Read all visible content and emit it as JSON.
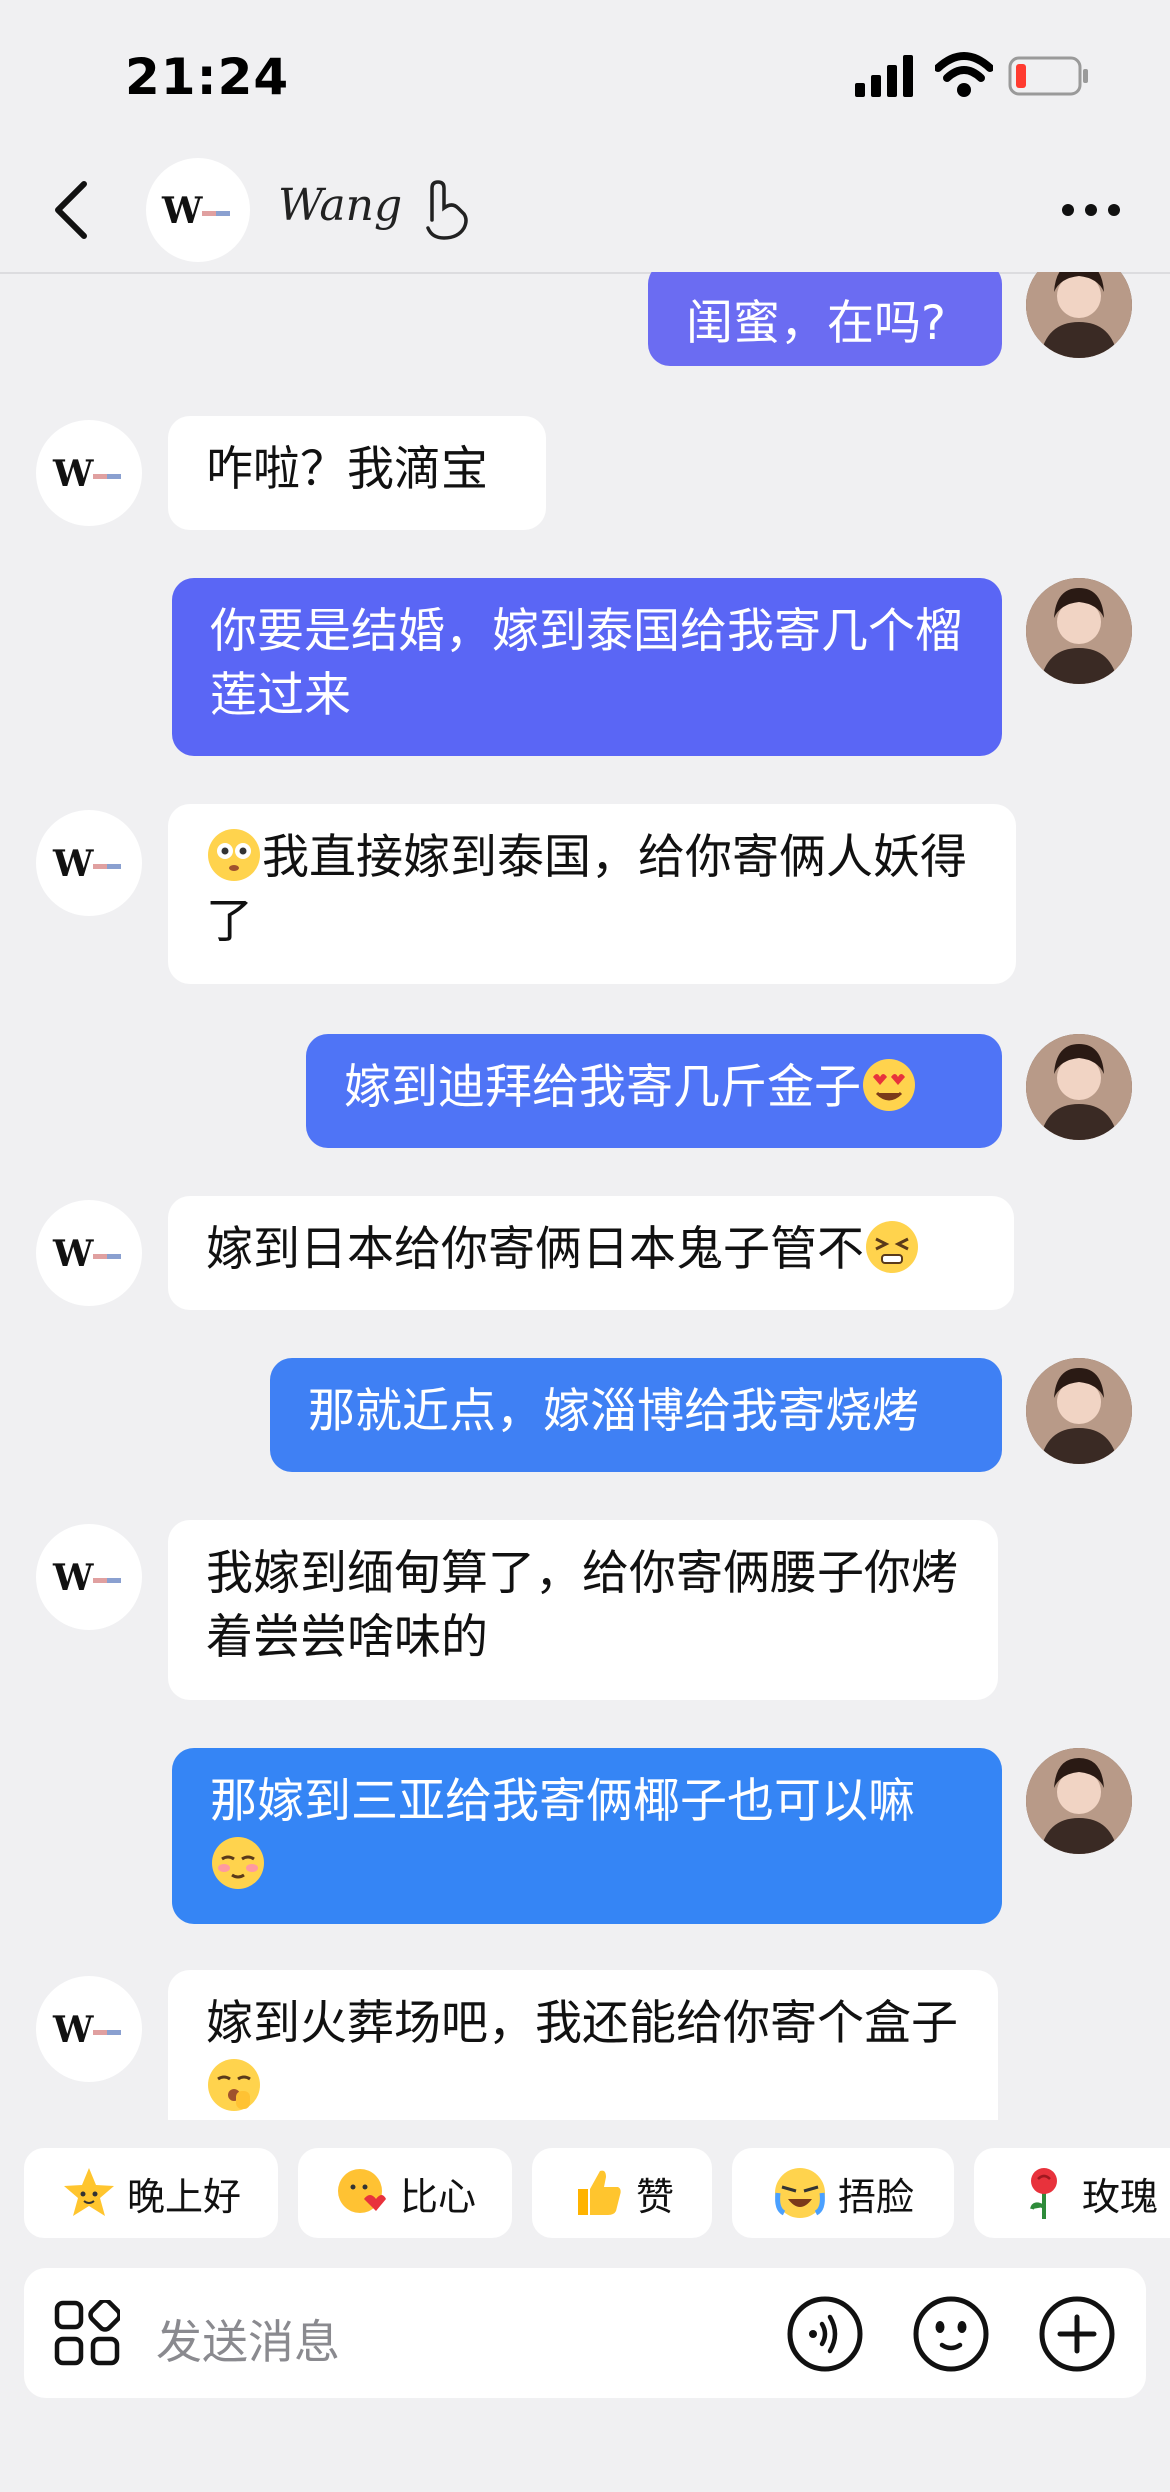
{
  "status_bar": {
    "time": "21:24"
  },
  "header": {
    "contact_name": "Wang",
    "avatar_text": "W"
  },
  "messages": [
    {
      "side": "out",
      "text": "闺蜜，在吗?"
    },
    {
      "side": "in",
      "text": "咋啦？我滴宝"
    },
    {
      "side": "out",
      "text": "你要是结婚，嫁到泰国给我寄几个榴莲过来"
    },
    {
      "side": "in",
      "text": "我直接嫁到泰国，给你寄俩人妖得了",
      "emoji_lead": "flushed-face"
    },
    {
      "side": "out",
      "text": "嫁到迪拜给我寄几斤金子",
      "emoji_tail": "heart-eyes-face"
    },
    {
      "side": "in",
      "text": "嫁到日本给你寄俩日本鬼子管不",
      "emoji_tail": "squinting-face"
    },
    {
      "side": "out",
      "text": "那就近点，嫁淄博给我寄烧烤"
    },
    {
      "side": "in",
      "text": "我嫁到缅甸算了，给你寄俩腰子你烤着尝尝啥味的"
    },
    {
      "side": "out",
      "text": "那嫁到三亚给我寄俩椰子也可以嘛",
      "emoji_tail": "shy-face"
    },
    {
      "side": "in",
      "text": "嫁到火葬场吧，我还能给你寄个盒子",
      "emoji_tail": "shushing-face"
    }
  ],
  "quick_replies": [
    {
      "label": "晚上好",
      "icon": "star-emoji"
    },
    {
      "label": "比心",
      "icon": "heart-hands-emoji"
    },
    {
      "label": "赞",
      "icon": "thumbs-up-emoji"
    },
    {
      "label": "捂脸",
      "icon": "facepalm-emoji"
    },
    {
      "label": "玫瑰",
      "icon": "rose-emoji"
    }
  ],
  "input": {
    "placeholder": "发送消息"
  },
  "colors": {
    "background": "#f0f0f2",
    "incoming_bubble": "#ffffff",
    "outgoing_gradient": [
      "#6b6cf2",
      "#5a66f5",
      "#4f74f6",
      "#3f80f4",
      "#3585f5",
      "#2f8af6"
    ]
  }
}
